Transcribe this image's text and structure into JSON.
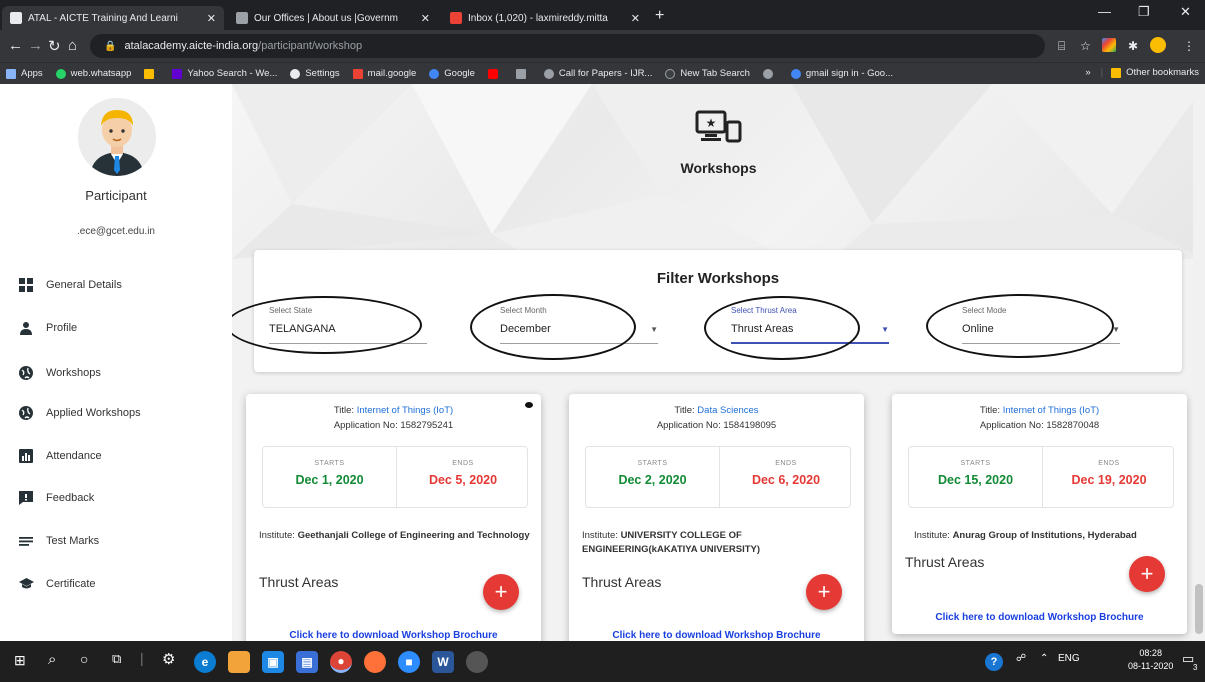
{
  "browser": {
    "tabs": [
      {
        "label": "ATAL - AICTE Training And Learni",
        "favicon_color": "#e8eaed",
        "active": true
      },
      {
        "label": "Our Offices | About us |Governm",
        "favicon_color": "#9aa0a6",
        "active": false
      },
      {
        "label": "Inbox (1,020) - laxmireddy.mitta",
        "favicon_color": "#ea4335",
        "active": false
      }
    ],
    "url_domain": "atalacademy.aicte-india.org",
    "url_path": "/participant/workshop",
    "bookmarks": [
      {
        "label": "Apps",
        "color": "#8ab4f8"
      },
      {
        "label": "web.whatsapp",
        "color": "#25d366"
      },
      {
        "label": "",
        "color": "#fbbc04"
      },
      {
        "label": "Yahoo Search - We...",
        "color": "#6001d2"
      },
      {
        "label": "Settings",
        "color": "#e8eaed"
      },
      {
        "label": "mail.google",
        "color": "#ea4335"
      },
      {
        "label": "Google",
        "color": "#4285f4"
      },
      {
        "label": "",
        "color": "#ff0000"
      },
      {
        "label": "",
        "color": "#9aa0a6"
      },
      {
        "label": "Call for Papers - IJR...",
        "color": "#9aa0a6"
      },
      {
        "label": "New Tab Search",
        "color": "#3c4043"
      },
      {
        "label": "",
        "color": "#9aa0a6"
      },
      {
        "label": "gmail sign in - Goo...",
        "color": "#4285f4"
      }
    ],
    "bookmarks_overflow": "»",
    "other_bookmarks": "Other bookmarks"
  },
  "sidebar": {
    "role": "Participant",
    "email": ".ece@gcet.edu.in",
    "items": [
      {
        "label": "General Details",
        "icon": "grid-icon"
      },
      {
        "label": "Profile",
        "icon": "person-icon"
      },
      {
        "label": "Workshops",
        "icon": "globe-icon"
      },
      {
        "label": "Applied Workshops",
        "icon": "globe-icon"
      },
      {
        "label": "Attendance",
        "icon": "chart-icon"
      },
      {
        "label": "Feedback",
        "icon": "feedback-icon"
      },
      {
        "label": "Test Marks",
        "icon": "lines-icon"
      },
      {
        "label": "Certificate",
        "icon": "cap-icon"
      }
    ]
  },
  "hero": {
    "title": "Workshops"
  },
  "filter": {
    "title": "Filter Workshops",
    "state": {
      "label": "Select State",
      "value": "TELANGANA"
    },
    "month": {
      "label": "Select Month",
      "value": "December"
    },
    "thrust": {
      "label": "Select Thrust Area",
      "value": "Thrust Areas"
    },
    "mode": {
      "label": "Select Mode",
      "value": "Online"
    }
  },
  "cards": [
    {
      "title_prefix": "Title: ",
      "title": "Internet of Things (IoT)",
      "app_no": "Application No: 1582795241",
      "starts_label": "STARTS",
      "ends_label": "ENDS",
      "start": "Dec 1, 2020",
      "end": "Dec 5, 2020",
      "institute_prefix": "Institute: ",
      "institute": "Geethanjali College of Engineering and Technology",
      "thrust": "Thrust Areas",
      "fab": "+",
      "brochure": "Click here to download Workshop Brochure"
    },
    {
      "title_prefix": "Title: ",
      "title": "Data Sciences",
      "app_no": "Application No: 1584198095",
      "starts_label": "STARTS",
      "ends_label": "ENDS",
      "start": "Dec 2, 2020",
      "end": "Dec 6, 2020",
      "institute_prefix": "Institute: ",
      "institute": "UNIVERSITY COLLEGE OF ENGINEERING(kAKATIYA UNIVERSITY)",
      "thrust": "Thrust Areas",
      "fab": "+",
      "brochure": "Click here to download Workshop Brochure"
    },
    {
      "title_prefix": "Title: ",
      "title": "Internet of Things (IoT)",
      "app_no": "Application No: 1582870048",
      "starts_label": "STARTS",
      "ends_label": "ENDS",
      "start": "Dec 15, 2020",
      "end": "Dec 19, 2020",
      "institute_prefix": "Institute: ",
      "institute": "Anurag Group of Institutions, Hyderabad",
      "thrust": "Thrust Areas",
      "fab": "+",
      "brochure": "Click here to download Workshop Brochure"
    }
  ],
  "taskbar": {
    "apps": [
      {
        "name": "edge",
        "color": "#0a7cd1"
      },
      {
        "name": "paint",
        "color": "#f2a33a"
      },
      {
        "name": "store",
        "color": "#1e88e5"
      },
      {
        "name": "files",
        "color": "#3a6fd8"
      },
      {
        "name": "chrome",
        "color": "#db4437"
      },
      {
        "name": "firefox",
        "color": "#ff7139"
      },
      {
        "name": "zoom",
        "color": "#2d8cff"
      },
      {
        "name": "word",
        "color": "#2b579a"
      },
      {
        "name": "paint3d",
        "color": "#666"
      }
    ],
    "lang": "ENG",
    "time": "08:28",
    "date": "08-11-2020",
    "notifications": "3"
  }
}
